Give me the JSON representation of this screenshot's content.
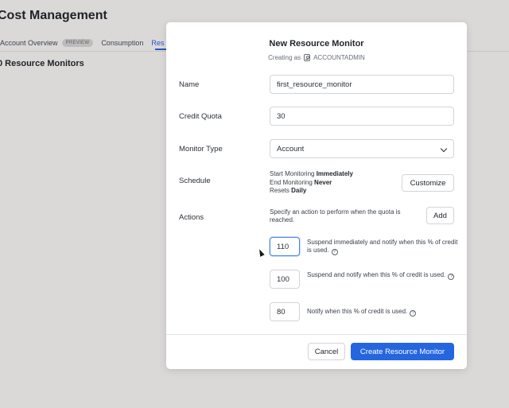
{
  "background": {
    "title": "Cost Management",
    "tabs": [
      {
        "label": "Account Overview",
        "badge": "PREVIEW"
      },
      {
        "label": "Consumption"
      },
      {
        "label": "Res"
      }
    ],
    "count_heading": "0 Resource Monitors"
  },
  "modal": {
    "title": "New Resource Monitor",
    "creating_as_prefix": "Creating as",
    "role": "ACCOUNTADMIN",
    "name_label": "Name",
    "name_value": "first_resource_monitor",
    "credit_quota_label": "Credit Quota",
    "credit_quota_value": "30",
    "monitor_type_label": "Monitor Type",
    "monitor_type_value": "Account",
    "schedule_label": "Schedule",
    "schedule": {
      "start_prefix": "Start Monitoring",
      "start_value": "Immediately",
      "end_prefix": "End Monitoring",
      "end_value": "Never",
      "resets_prefix": "Resets",
      "resets_value": "Daily"
    },
    "customize_label": "Customize",
    "actions_label": "Actions",
    "actions_description": "Specify an action to perform when the quota is reached.",
    "add_label": "Add",
    "actions": [
      {
        "value": "110",
        "text": "Suspend immediately and notify when this % of credit is used."
      },
      {
        "value": "100",
        "text": "Suspend and notify when this % of credit is used."
      },
      {
        "value": "80",
        "text": "Notify when this % of credit is used."
      }
    ],
    "cancel_label": "Cancel",
    "create_label": "Create Resource Monitor"
  },
  "colors": {
    "primary": "#2566e0",
    "focus": "#4a86e8",
    "overlay": "#dbd9d8"
  }
}
